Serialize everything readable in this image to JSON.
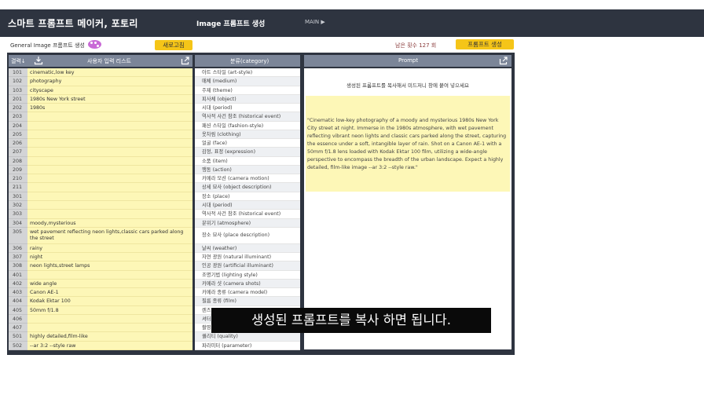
{
  "header": {
    "app_title": "스마트 프롬프트 메이커, 포토리",
    "center_title": "Image 프롬프트 생성",
    "nav_label": "MAIN ▶"
  },
  "toolbar": {
    "mode_label": "General Image 프롬프트 생성",
    "reset_label": "새로고침",
    "remaining_label": "남은 횟수 127 회",
    "generate_label": "프롬프트 생성"
  },
  "columns": {
    "col_order": "결력↓",
    "col_input": "사용자 입력 리스트",
    "col_category": "분류(category)",
    "col_prompt": "Prompt"
  },
  "rows": [
    {
      "num": "101",
      "value": "cinematic,low key",
      "category": "아트 스타일 (art-style)"
    },
    {
      "num": "102",
      "value": "photography",
      "category": "매체 (medium)"
    },
    {
      "num": "103",
      "value": "cityscape",
      "category": "주제 (theme)"
    },
    {
      "num": "201",
      "value": "1980s New York street",
      "category": "피사체 (object)"
    },
    {
      "num": "202",
      "value": "1980s",
      "category": "시대 (period)"
    },
    {
      "num": "203",
      "value": "",
      "category": "역사적 사건 참조 (historical event)"
    },
    {
      "num": "204",
      "value": "",
      "category": "패션 스타일 (fashion-style)"
    },
    {
      "num": "205",
      "value": "",
      "category": "옷차림 (clothing)"
    },
    {
      "num": "206",
      "value": "",
      "category": "얼굴 (face)"
    },
    {
      "num": "207",
      "value": "",
      "category": "감정, 표정 (expression)"
    },
    {
      "num": "208",
      "value": "",
      "category": "소품 (item)"
    },
    {
      "num": "209",
      "value": "",
      "category": "행동 (action)"
    },
    {
      "num": "210",
      "value": "",
      "category": "카메라 모션 (camera motion)"
    },
    {
      "num": "211",
      "value": "",
      "category": "상세 묘사 (object description)"
    },
    {
      "num": "301",
      "value": "",
      "category": "장소 (place)"
    },
    {
      "num": "302",
      "value": "",
      "category": "시대 (period)"
    },
    {
      "num": "303",
      "value": "",
      "category": "역사적 사건 참조 (historical event)"
    },
    {
      "num": "304",
      "value": "moody,mysterious",
      "category": "분위기 (atmosphere)"
    },
    {
      "num": "305",
      "value": "wet pavement reflecting neon lights,classic cars parked along the street",
      "category": "장소 묘사 (place description)"
    },
    {
      "num": "306",
      "value": "rainy",
      "category": "날씨 (weather)"
    },
    {
      "num": "307",
      "value": "night",
      "category": "자연 광원 (natural illuminant)"
    },
    {
      "num": "308",
      "value": "neon lights,street lamps",
      "category": "인공 광원 (artificial illuminant)"
    },
    {
      "num": "401",
      "value": "",
      "category": "조명기법 (lighting style)"
    },
    {
      "num": "402",
      "value": "wide angle",
      "category": "카메라 샷 (camera shots)"
    },
    {
      "num": "403",
      "value": "Canon AE-1",
      "category": "카메라 종류 (camera model)"
    },
    {
      "num": "404",
      "value": "Kodak Ektar 100",
      "category": "필름 종류 (film)"
    },
    {
      "num": "405",
      "value": "50mm f/1.8",
      "category": "렌즈"
    },
    {
      "num": "406",
      "value": "",
      "category": "셔터"
    },
    {
      "num": "407",
      "value": "",
      "category": "촬영"
    },
    {
      "num": "501",
      "value": "highly detailed,film-like",
      "category": "퀄리티 (quality)"
    },
    {
      "num": "502",
      "value": "--ar 3:2 --style raw",
      "category": "파라미터 (parameter)"
    }
  ],
  "prompt_panel": {
    "note": "생성된 프롬프트를 복사해서 미드저니 창에 붙여 넣으세요",
    "text": "\"Cinematic low-key photography of a moody and mysterious 1980s New York City street at night. Immerse in the 1980s atmosphere, with wet pavement reflecting vibrant neon lights and classic cars parked along the street, capturing the essence under a soft, intangible layer of rain. Shot on a Canon AE-1 with a 50mm f/1.8 lens loaded with Kodak Ektar 100 film, utilizing a wide-angle perspective to encompass the breadth of the urban landscape. Expect a highly detailed, film-like image --ar 3:2 --style raw.\""
  },
  "subtitle": "생성된 프롬프트를 복사 하면 됩니다.",
  "colors": {
    "dark": "#2e3440",
    "header_gray": "#7b8598",
    "yellow": "#f5c518",
    "pale_yellow": "#fdf7b7",
    "palette": "#c86ad6"
  }
}
